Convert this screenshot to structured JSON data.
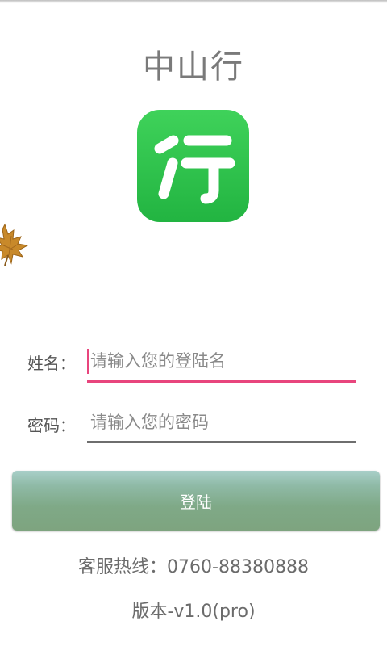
{
  "app": {
    "title": "中山行",
    "logo_glyph": "行",
    "logo_colors": [
      "#3fd25a",
      "#22b441"
    ]
  },
  "form": {
    "name_label": "姓名：",
    "name_placeholder": "请输入您的登陆名",
    "name_value": "",
    "password_label": "密码：",
    "password_placeholder": "请输入您的密码",
    "password_value": ""
  },
  "login_button": {
    "label": "登陆"
  },
  "footer": {
    "hotline": "客服热线：0760-88380888",
    "version": "版本-v1.0(pro)"
  },
  "colors": {
    "accent": "#e8457d",
    "button": "#7fa987"
  }
}
